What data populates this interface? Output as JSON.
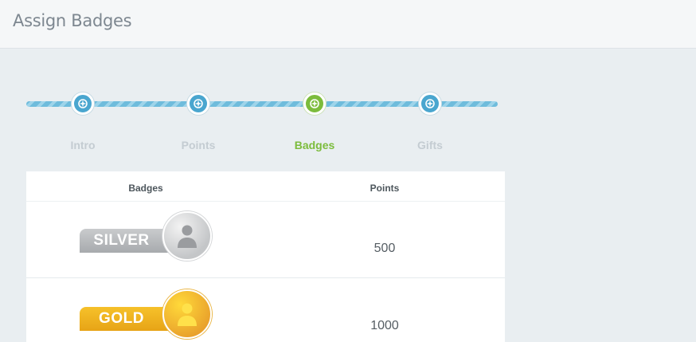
{
  "header": {
    "title": "Assign Badges"
  },
  "steps": [
    {
      "label": "Intro",
      "icon": "compass-icon",
      "active": false
    },
    {
      "label": "Points",
      "icon": "compass-icon",
      "active": false
    },
    {
      "label": "Badges",
      "icon": "compass-icon",
      "active": true
    },
    {
      "label": "Gifts",
      "icon": "compass-icon",
      "active": false
    }
  ],
  "colors": {
    "step": "#4aa6cf",
    "active_step": "#7cbc3c",
    "silver": "#b6b8bb",
    "gold": "#f0b323"
  },
  "table": {
    "headers": {
      "badges": "Badges",
      "points": "Points"
    },
    "rows": [
      {
        "badge": "SILVER",
        "icon": "user-icon",
        "points": "500"
      },
      {
        "badge": "GOLD",
        "icon": "user-icon",
        "points": "1000"
      }
    ]
  }
}
